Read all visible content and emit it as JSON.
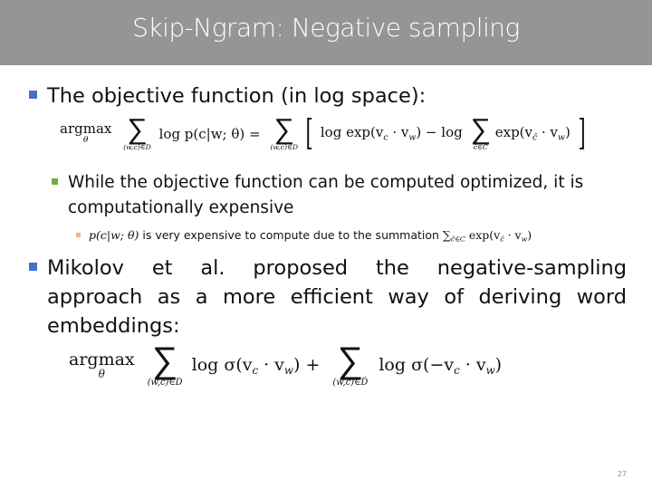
{
  "slide": {
    "title": "Skip-Ngram: Negative sampling",
    "page_number": "27",
    "colors": {
      "title_bar": "#959595",
      "title_text": "#ffffff",
      "bullet_level1": "#4472c4",
      "bullet_level2": "#70ad47",
      "bullet_level3": "#f4b183"
    }
  },
  "bullets": {
    "b1": {
      "text": "The objective function (in log space):",
      "formula": {
        "argmax": "argmax",
        "argmax_under": "θ",
        "sum1_under": "(w,c)∈D",
        "term1": "log p(c|w; θ) =",
        "sum2_under": "(w,c)∈D",
        "term2": "log exp(v",
        "term2_sub": "c",
        "term2_mid": " · v",
        "term2_sub2": "w",
        "term2_end": ") − log",
        "sum3_under": "ĉ∈C",
        "term3": "exp(v",
        "term3_sub": "ĉ",
        "term3_mid": " · v",
        "term3_sub2": "w",
        "term3_end": ")"
      },
      "sub": {
        "text_line1": "While the objective function can be computed optimized, it is",
        "text_line2": "computationally expensive",
        "subsub": {
          "math_prefix": "p(c|w; θ)",
          "text": " is very expensive to compute due to the summation ",
          "math_suffix": "∑",
          "math_suffix_sub": "ĉ∈C",
          "math_suffix_tail": " exp(v",
          "math_suffix_tail_sub": "ĉ",
          "math_suffix_tail2": " · v",
          "math_suffix_tail_sub2": "w",
          "math_suffix_tail3": ")"
        }
      }
    },
    "b2": {
      "line1": "Mikolov et al. proposed the negative-sampling",
      "line2": "approach as a more efficient way of deriving word",
      "line3": "embeddings:",
      "formula": {
        "argmax": "argmax",
        "argmax_under": "θ",
        "sum1_under": "(w,c)∈D",
        "term1": "log σ(v",
        "term1_sub": "c",
        "term1_mid": " · v",
        "term1_sub2": "w",
        "term1_end": ") +",
        "sum2_under": "(w,c)∈D́",
        "term2": "log σ(−v",
        "term2_sub": "c",
        "term2_mid": " · v",
        "term2_sub2": "w",
        "term2_end": ")"
      }
    }
  }
}
